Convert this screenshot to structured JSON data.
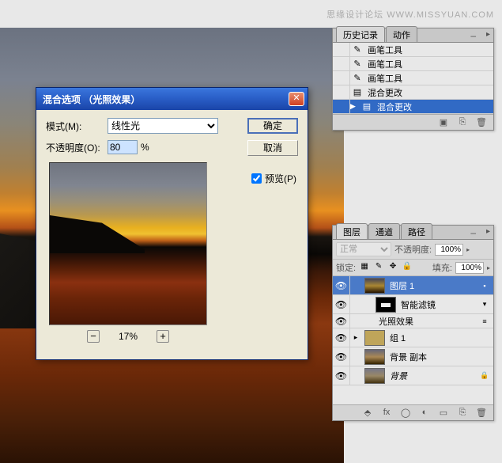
{
  "watermark": "思缘设计论坛 WWW.MISSYUAN.COM",
  "dialog": {
    "title": "混合选项 （光照效果）",
    "mode_label": "模式(M):",
    "mode_value": "线性光",
    "opacity_label": "不透明度(O):",
    "opacity_value": "80",
    "percent": "%",
    "ok": "确定",
    "cancel": "取消",
    "preview": "预览(P)",
    "zoom_pct": "17%",
    "minus": "−",
    "plus": "+"
  },
  "history": {
    "tab1": "历史记录",
    "tab2": "动作",
    "items": [
      {
        "icon": "brush",
        "label": "画笔工具"
      },
      {
        "icon": "brush",
        "label": "画笔工具"
      },
      {
        "icon": "brush",
        "label": "画笔工具"
      },
      {
        "icon": "doc",
        "label": "混合更改"
      },
      {
        "icon": "doc",
        "label": "混合更改"
      }
    ]
  },
  "layers": {
    "tab1": "图层",
    "tab2": "通道",
    "tab3": "路径",
    "blend_mode": "正常",
    "opacity_label": "不透明度:",
    "opacity_val": "100%",
    "lock_label": "锁定:",
    "fill_label": "填充:",
    "fill_val": "100%",
    "rows": [
      {
        "name": "图层 1",
        "sel": true,
        "thumb": "sunset"
      },
      {
        "name": "智能滤镜",
        "thumb": "dark",
        "indent": true
      },
      {
        "name": "光照效果",
        "effect": true
      },
      {
        "name": "组 1",
        "thumb": "folder",
        "group": true
      },
      {
        "name": "背景 副本",
        "thumb": "bg"
      },
      {
        "name": "背景",
        "thumb": "bg2",
        "italic": true,
        "locked": true
      }
    ]
  }
}
